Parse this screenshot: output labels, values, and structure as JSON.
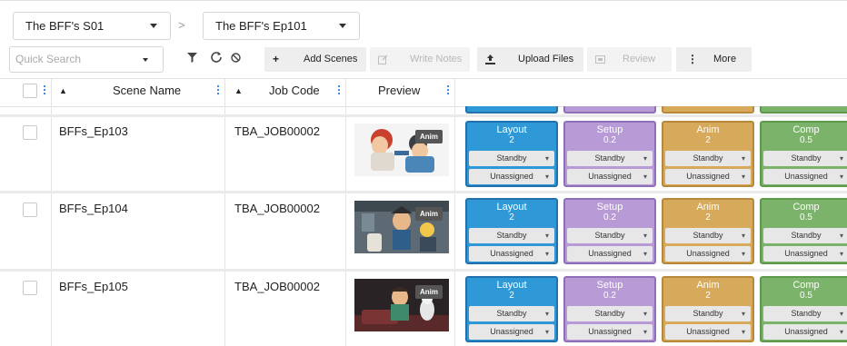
{
  "season_select": {
    "value": "The BFF's S01"
  },
  "episode_select": {
    "value": "The BFF's Ep101"
  },
  "breadcrumb_sep": ">",
  "toolbar": {
    "quick_search_placeholder": "Quick Search",
    "add_scenes": "Add Scenes",
    "write_notes": "Write Notes",
    "upload_files": "Upload Files",
    "review": "Review",
    "more": "More"
  },
  "columns": {
    "scene_name": "Scene Name",
    "job_code": "Job Code",
    "preview": "Preview"
  },
  "rows": [
    {
      "scene_name": "BFFs_Ep103",
      "job_code": "TBA_JOB00002",
      "badge": "Anim",
      "tasks": [
        {
          "name": "Layout",
          "value": "2",
          "status": "Standby",
          "assignee": "Unassigned"
        },
        {
          "name": "Setup",
          "value": "0.2",
          "status": "Standby",
          "assignee": "Unassigned"
        },
        {
          "name": "Anim",
          "value": "2",
          "status": "Standby",
          "assignee": "Unassigned"
        },
        {
          "name": "Comp",
          "value": "0.5",
          "status": "Standby",
          "assignee": "Unassigned"
        }
      ]
    },
    {
      "scene_name": "BFFs_Ep104",
      "job_code": "TBA_JOB00002",
      "badge": "Anim",
      "tasks": [
        {
          "name": "Layout",
          "value": "2",
          "status": "Standby",
          "assignee": "Unassigned"
        },
        {
          "name": "Setup",
          "value": "0.2",
          "status": "Standby",
          "assignee": "Unassigned"
        },
        {
          "name": "Anim",
          "value": "2",
          "status": "Standby",
          "assignee": "Unassigned"
        },
        {
          "name": "Comp",
          "value": "0.5",
          "status": "Standby",
          "assignee": "Unassigned"
        }
      ]
    },
    {
      "scene_name": "BFFs_Ep105",
      "job_code": "TBA_JOB00002",
      "badge": "Anim",
      "tasks": [
        {
          "name": "Layout",
          "value": "2",
          "status": "Standby",
          "assignee": "Unassigned"
        },
        {
          "name": "Setup",
          "value": "0.2",
          "status": "Standby",
          "assignee": "Unassigned"
        },
        {
          "name": "Anim",
          "value": "2",
          "status": "Standby",
          "assignee": "Unassigned"
        },
        {
          "name": "Comp",
          "value": "0.5",
          "status": "Standby",
          "assignee": "Unassigned"
        }
      ]
    }
  ],
  "colors": {
    "layout": "#2f98d6",
    "setup": "#b79ad6",
    "anim": "#d6aa5a",
    "comp": "#7cb36b",
    "accent": "#3a8ee6"
  },
  "icons": [
    "filter-icon",
    "refresh-icon",
    "clear-filter-icon",
    "plus-icon",
    "edit-icon",
    "upload-icon",
    "review-icon",
    "more-icon",
    "sort-icon",
    "column-menu-icon",
    "caret-down-icon"
  ]
}
